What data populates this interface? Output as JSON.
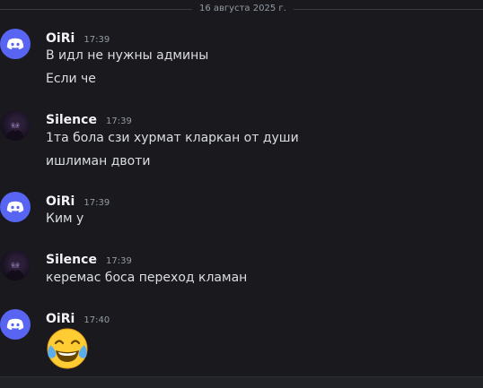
{
  "date_divider": "16 августа 2025 г.",
  "messages": [
    {
      "author": "OiRi",
      "time": "17:39",
      "avatar": "discord-logo-icon",
      "lines": [
        "В идл не нужны админы",
        "Если че"
      ]
    },
    {
      "author": "Silence",
      "time": "17:39",
      "avatar": "dark-character-avatar",
      "lines": [
        "1та бола сзи хурмат кларкан от души",
        "ишлиман двоти"
      ]
    },
    {
      "author": "OiRi",
      "time": "17:39",
      "avatar": "discord-logo-icon",
      "lines": [
        "Ким у"
      ]
    },
    {
      "author": "Silence",
      "time": "17:39",
      "avatar": "dark-character-avatar",
      "lines": [
        "керемас боса переход кламан"
      ]
    },
    {
      "author": "OiRi",
      "time": "17:40",
      "avatar": "discord-logo-icon",
      "emoji": "face-with-tears-of-joy"
    }
  ],
  "colors": {
    "background": "#1a1a1e",
    "discord_blurple": "#5865f2",
    "username": "#f2f3f5",
    "text": "#dbdee1",
    "muted": "#949ba4"
  }
}
